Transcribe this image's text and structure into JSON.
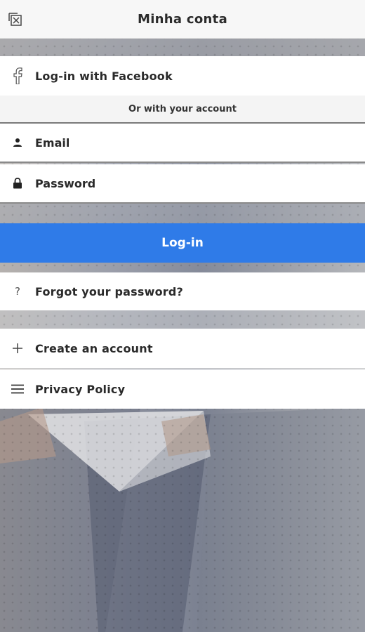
{
  "header": {
    "title": "Minha conta",
    "close_icon": "close-window-icon"
  },
  "facebook": {
    "label": "Log-in with Facebook",
    "icon": "facebook-icon"
  },
  "separator": {
    "text": "Or with your account"
  },
  "form": {
    "email": {
      "placeholder": "Email",
      "value": "",
      "icon": "user-icon"
    },
    "password": {
      "placeholder": "Password",
      "value": "",
      "icon": "lock-icon"
    },
    "login_label": "Log-in"
  },
  "menu": {
    "forgot": {
      "label": "Forgot your password?",
      "icon": "question-icon"
    },
    "create": {
      "label": "Create an account",
      "icon": "plus-icon"
    },
    "privacy": {
      "label": "Privacy Policy",
      "icon": "menu-icon"
    }
  },
  "colors": {
    "accent": "#2f7be8",
    "header_bg": "#f7f7f7",
    "row_bg": "#ffffff"
  }
}
